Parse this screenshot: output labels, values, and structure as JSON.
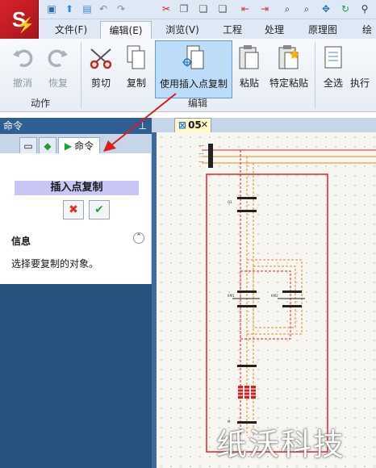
{
  "logo_text": "S",
  "menu": {
    "tabs": [
      "文件(F)",
      "编辑(E)",
      "浏览(V)",
      "工程",
      "处理",
      "原理图",
      "绘"
    ],
    "active": "编辑(E)"
  },
  "ribbon": {
    "undo": "撤消",
    "redo": "恢复",
    "action_group": "动作",
    "cut": "剪切",
    "copy": "复制",
    "copy_with_insert_point": "使用插入点复制",
    "paste": "粘贴",
    "paste_special": "特定粘贴",
    "edit_group": "编辑",
    "select_all": "全选",
    "execute": "执行"
  },
  "left_panel": {
    "title": "命令",
    "tab_command": "命令",
    "command_title": "插入点复制",
    "info_heading": "信息",
    "info_text": "选择要复制的对象。"
  },
  "document": {
    "tab_label": "05"
  },
  "watermark": "纸沃科技",
  "colors": {
    "panel_blue": "#2e5e92",
    "highlight": "#bcdcf8",
    "frame_red": "#e0242a",
    "wire_orange": "#e38b1f",
    "arrow_red": "#e01b1b"
  }
}
